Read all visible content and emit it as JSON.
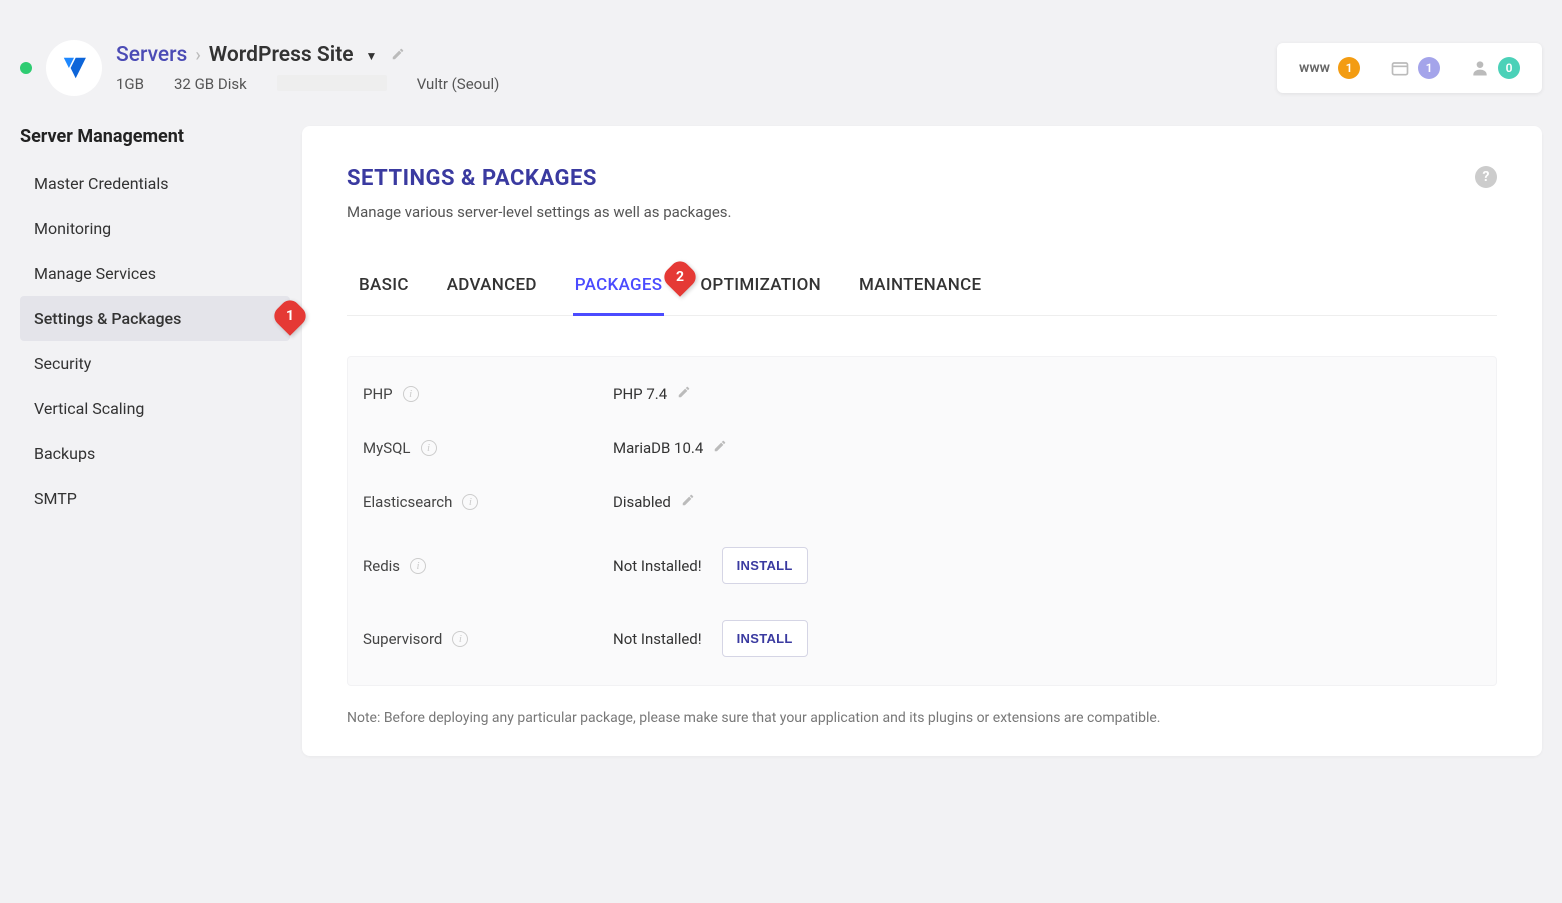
{
  "header": {
    "breadcrumb_root": "Servers",
    "site_name": "WordPress Site",
    "stats": {
      "ram": "1GB",
      "disk": "32 GB Disk",
      "provider": "Vultr (Seoul)"
    },
    "www_label": "www",
    "www_count": "1",
    "apps_count": "1",
    "users_count": "0"
  },
  "sidebar": {
    "title": "Server Management",
    "items": [
      {
        "label": "Master Credentials"
      },
      {
        "label": "Monitoring"
      },
      {
        "label": "Manage Services"
      },
      {
        "label": "Settings & Packages"
      },
      {
        "label": "Security"
      },
      {
        "label": "Vertical Scaling"
      },
      {
        "label": "Backups"
      },
      {
        "label": "SMTP"
      }
    ]
  },
  "annotations": {
    "sidebar": "1",
    "tab": "2"
  },
  "card": {
    "title": "SETTINGS & PACKAGES",
    "subtitle": "Manage various server-level settings as well as packages.",
    "help": "?"
  },
  "tabs": {
    "basic": "BASIC",
    "advanced": "ADVANCED",
    "packages": "PACKAGES",
    "optimization": "OPTIMIZATION",
    "maintenance": "MAINTENANCE"
  },
  "packages": {
    "php": {
      "label": "PHP",
      "value": "PHP 7.4"
    },
    "mysql": {
      "label": "MySQL",
      "value": "MariaDB 10.4"
    },
    "elasticsearch": {
      "label": "Elasticsearch",
      "value": "Disabled"
    },
    "redis": {
      "label": "Redis",
      "value": "Not Installed!",
      "action": "INSTALL"
    },
    "supervisord": {
      "label": "Supervisord",
      "value": "Not Installed!",
      "action": "INSTALL"
    }
  },
  "footnote": "Note: Before deploying any particular package, please make sure that your application and its plugins or extensions are compatible."
}
